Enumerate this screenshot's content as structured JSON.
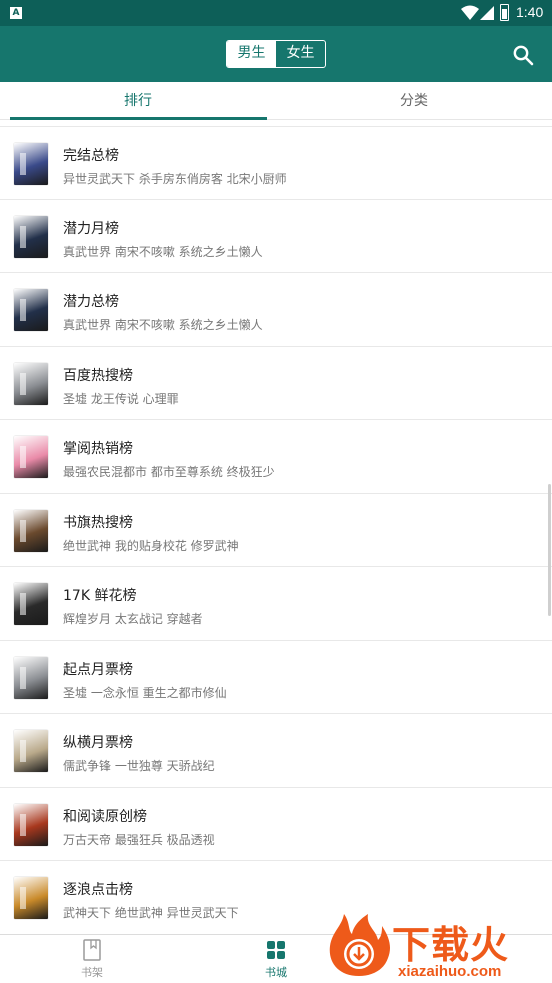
{
  "status_bar": {
    "time": "1:40",
    "app_badge": "A"
  },
  "header": {
    "gender_toggle": [
      {
        "label": "男生",
        "selected": true
      },
      {
        "label": "女生",
        "selected": false
      }
    ],
    "search_icon": "search-icon"
  },
  "tabs": [
    {
      "label": "排行",
      "active": true
    },
    {
      "label": "分类",
      "active": false
    }
  ],
  "rankings": [
    {
      "title": "完结总榜",
      "books": "异世灵武天下 杀手房东俏房客 北宋小厨师",
      "cover_color": "#3a4a8a"
    },
    {
      "title": "潜力月榜",
      "books": "真武世界 南宋不咳嗽 系统之乡土懒人",
      "cover_color": "#22304a"
    },
    {
      "title": "潜力总榜",
      "books": "真武世界 南宋不咳嗽 系统之乡土懒人",
      "cover_color": "#22304a"
    },
    {
      "title": "百度热搜榜",
      "books": "圣墟 龙王传说 心理罪",
      "cover_color": "#8c8f94"
    },
    {
      "title": "掌阅热销榜",
      "books": "最强农民混都市 都市至尊系统 终极狂少",
      "cover_color": "#e98aa8"
    },
    {
      "title": "书旗热搜榜",
      "books": "绝世武神 我的贴身校花 修罗武神",
      "cover_color": "#6b4a2e"
    },
    {
      "title": "17K 鲜花榜",
      "books": "辉煌岁月 太玄战记 穿越者",
      "cover_color": "#2a2a2a"
    },
    {
      "title": "起点月票榜",
      "books": "圣墟 一念永恒 重生之都市修仙",
      "cover_color": "#8c8f94"
    },
    {
      "title": "纵横月票榜",
      "books": "儒武争锋 一世独尊 天骄战纪",
      "cover_color": "#b9a98a"
    },
    {
      "title": "和阅读原创榜",
      "books": "万古天帝 最强狂兵 极品透视",
      "cover_color": "#a8381e"
    },
    {
      "title": "逐浪点击榜",
      "books": "武神天下 绝世武神 异世灵武天下",
      "cover_color": "#c98a2a"
    }
  ],
  "bottom_nav": [
    {
      "label": "书架",
      "icon": "bookshelf-icon",
      "active": false
    },
    {
      "label": "书城",
      "icon": "bookstore-grid-icon",
      "active": true
    }
  ],
  "watermark": {
    "title": "下载火",
    "url": "xiazaihuo.com"
  },
  "colors": {
    "primary": "#16766d",
    "status_bar": "#0d5f58",
    "watermark": "#ee5a1a"
  }
}
